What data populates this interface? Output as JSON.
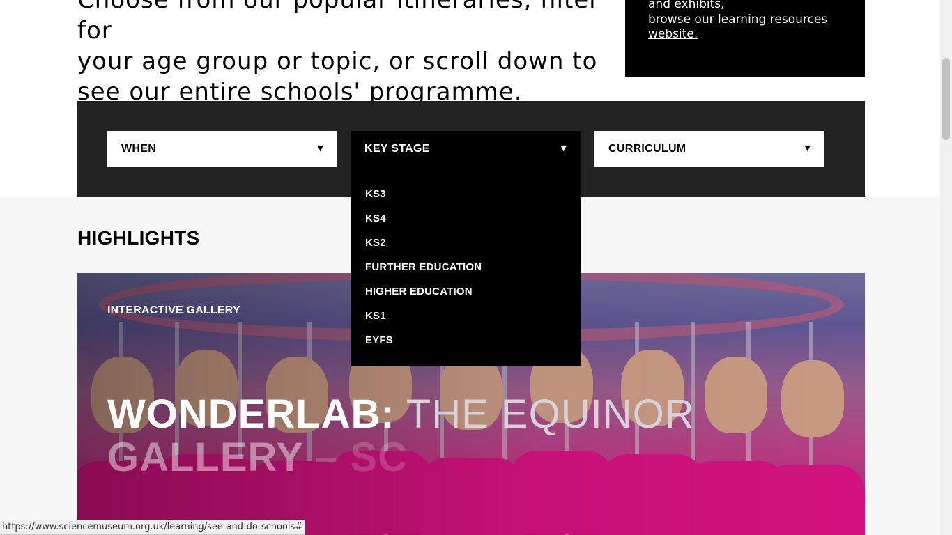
{
  "intro": {
    "line0": "Choose from our popular itineraries, filter for",
    "line1": "your age group or topic, or scroll down to",
    "line2": "see our entire schools' programme."
  },
  "resources": {
    "text": "and exhibits,",
    "link": "browse our learning resources website."
  },
  "filters": {
    "when": {
      "label": "WHEN",
      "arrow": "▼"
    },
    "key_stage": {
      "label": "KEY STAGE",
      "arrow": "▼"
    },
    "curriculum": {
      "label": "CURRICULUM",
      "arrow": "▼"
    }
  },
  "key_stage_options": [
    "KS3",
    "KS4",
    "KS2",
    "FURTHER EDUCATION",
    "HIGHER EDUCATION",
    "KS1",
    "EYFS"
  ],
  "highlights": {
    "title": "HIGHLIGHTS",
    "card": {
      "tag": "INTERACTIVE GALLERY",
      "title_part1": "WONDERLAB:",
      "title_part2": " THE EQUINOR",
      "title_part3": "GALLERY",
      "title_part4": " – SC"
    }
  },
  "status_bar": {
    "url": "https://www.sciencemuseum.org.uk/learning/see-and-do-schools#"
  },
  "colors": {
    "filter_bar": "#222222",
    "dropdown_bg": "#000000",
    "highlights_bg": "#f7f7f7",
    "hero_accent": "#d2127e"
  }
}
